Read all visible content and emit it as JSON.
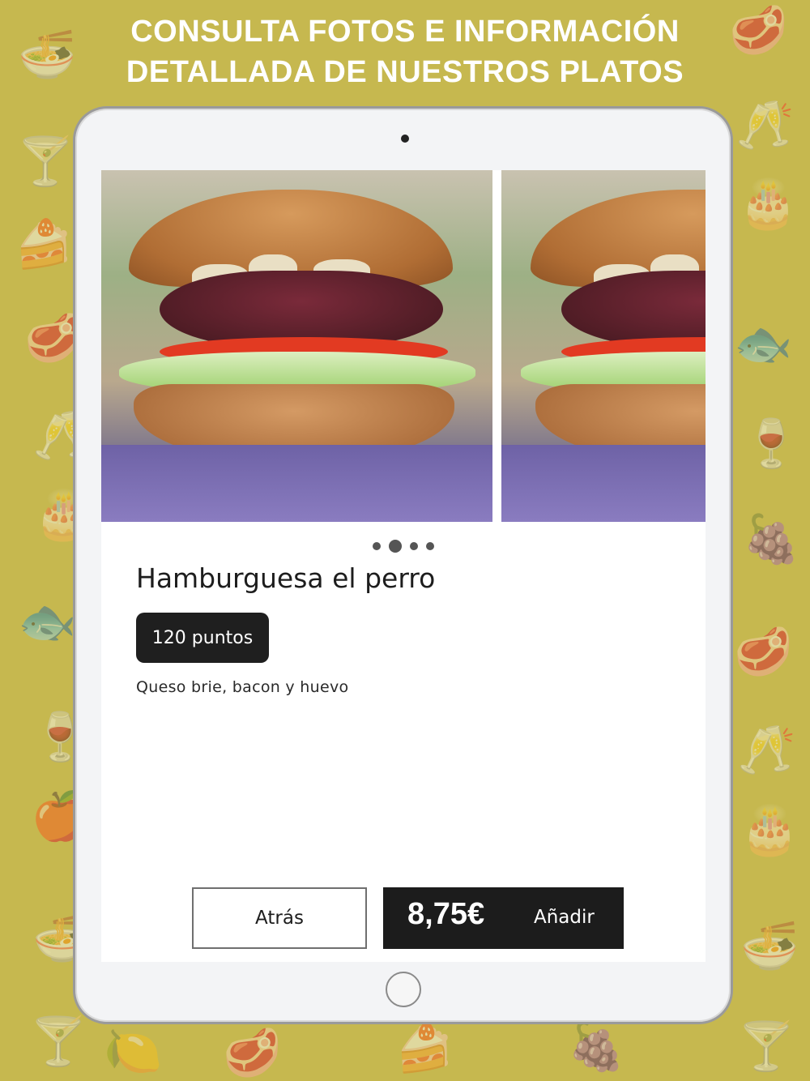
{
  "headline": {
    "line1": "CONSULTA FOTOS E INFORMACIÓN",
    "line2": "DETALLADA DE NUESTROS PLATOS"
  },
  "dish": {
    "name": "Hamburguesa el perro",
    "points": "120 puntos",
    "description": "Queso brie, bacon y huevo",
    "price": "8,75€"
  },
  "carousel": {
    "total_images": 4,
    "active_index": 1
  },
  "buttons": {
    "back_label": "Atrás",
    "add_label": "Añadir"
  },
  "colors": {
    "background": "#c6b84f",
    "dark_button": "#1c1c1c",
    "badge": "#1f1f1f"
  },
  "decorative_icons": [
    "noodle-bowl-icon",
    "steak-icon",
    "cocktail-icon",
    "wine-glasses-icon",
    "cake-icon",
    "fish-icon",
    "wine-bottle-icon",
    "fruit-icon",
    "citrus-icon"
  ]
}
